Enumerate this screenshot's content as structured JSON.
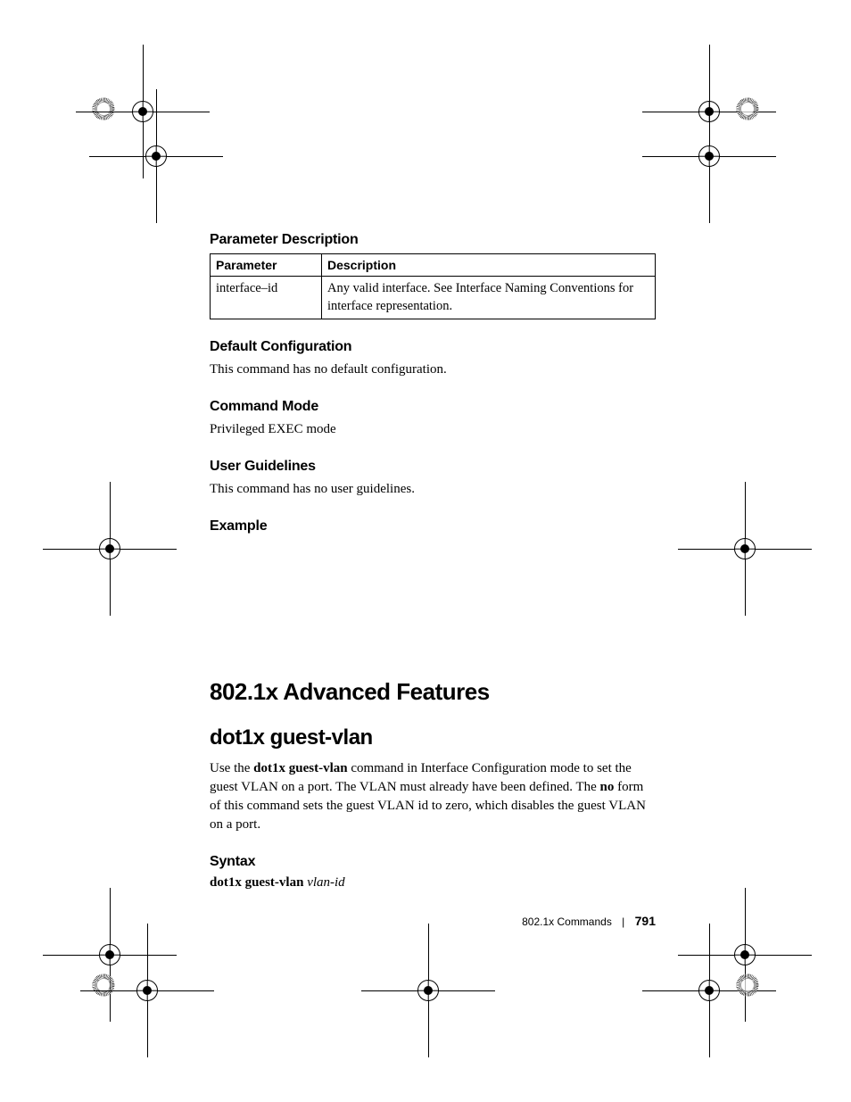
{
  "section1": {
    "heading": "Parameter Description",
    "table": {
      "headers": {
        "param": "Parameter",
        "desc": "Description"
      },
      "rows": [
        {
          "param": "interface–id",
          "desc": "Any valid interface. See Interface Naming Conventions for interface representation."
        }
      ]
    }
  },
  "section2": {
    "heading": "Default Configuration",
    "body": "This command has no default configuration."
  },
  "section3": {
    "heading": "Command Mode",
    "body": "Privileged EXEC mode"
  },
  "section4": {
    "heading": "User Guidelines",
    "body": "This command has no user guidelines."
  },
  "section5": {
    "heading": "Example"
  },
  "h1": "802.1x Advanced Features",
  "h2": "dot1x guest-vlan",
  "paragraph": {
    "p1a": "Use the ",
    "p1b": "dot1x guest-vlan",
    "p1c": " command in Interface Configuration mode to set the guest VLAN on a port. The VLAN must already have been defined. The ",
    "p1d": "no",
    "p1e": " form of this command sets the guest VLAN id to zero, which disables the guest VLAN on a port."
  },
  "section6": {
    "heading": "Syntax",
    "cmd_bold": "dot1x guest-vlan ",
    "cmd_italic": "vlan-id"
  },
  "footer": {
    "label": "802.1x Commands",
    "page": "791"
  }
}
